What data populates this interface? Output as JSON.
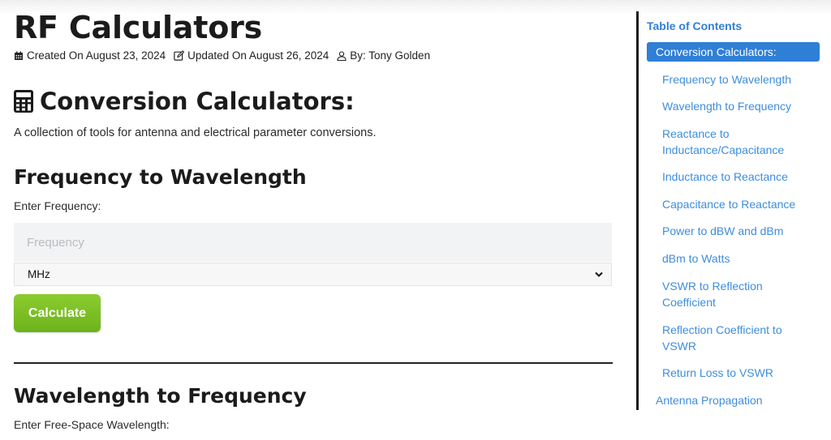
{
  "header": {
    "title": "RF Calculators",
    "created": "Created On August 23, 2024",
    "updated": "Updated On August 26, 2024",
    "author": "By: Tony Golden"
  },
  "section": {
    "title": "Conversion Calculators:",
    "intro": "A collection of tools for antenna and electrical parameter conversions."
  },
  "calc1": {
    "title": "Frequency to Wavelength",
    "input_label": "Enter Frequency:",
    "placeholder": "Frequency",
    "unit_selected": "MHz",
    "button_label": "Calculate"
  },
  "calc2": {
    "title": "Wavelength to Frequency",
    "input_label": "Enter Free-Space Wavelength:"
  },
  "toc": {
    "title": "Table of Contents",
    "active": "Conversion Calculators:",
    "items": [
      "Frequency to Wavelength",
      "Wavelength to Frequency",
      "Reactance to Inductance/Capacitance",
      "Inductance to Reactance",
      "Capacitance to Reactance",
      "Power to dBW and dBm",
      "dBm to Watts",
      "VSWR to Reflection Coefficient",
      "Reflection Coefficient to VSWR",
      "Return Loss to VSWR",
      "Antenna Propagation"
    ]
  },
  "colors": {
    "accent": "#2f7fd6",
    "button": "#7cbf24"
  }
}
